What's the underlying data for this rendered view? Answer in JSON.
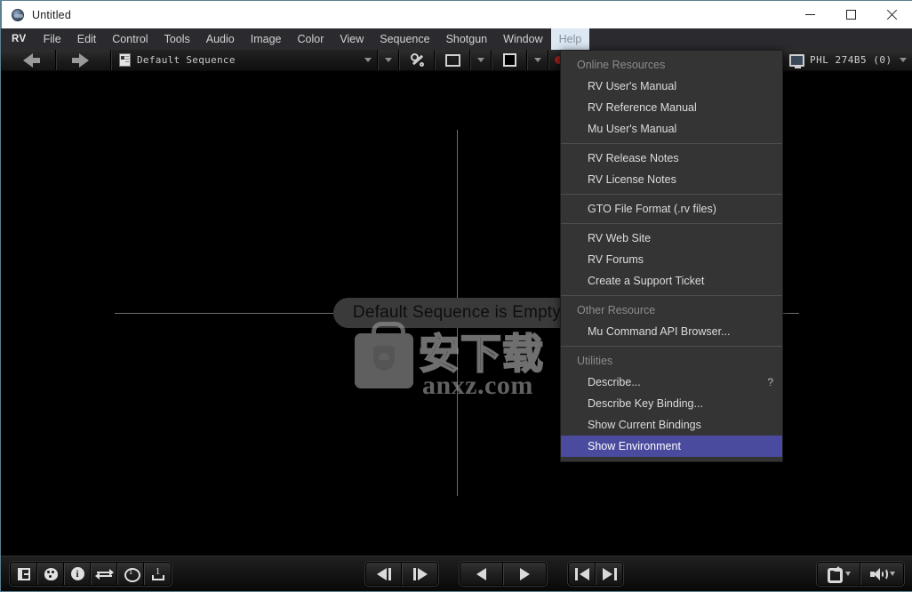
{
  "window": {
    "title": "Untitled",
    "icon": "rv-app-icon",
    "controls": {
      "minimize": "minimize-icon",
      "maximize": "maximize-icon",
      "close": "close-icon"
    }
  },
  "menubar": {
    "brand": "RV",
    "items": [
      {
        "label": "File",
        "active": false
      },
      {
        "label": "Edit",
        "active": false
      },
      {
        "label": "Control",
        "active": false
      },
      {
        "label": "Tools",
        "active": false
      },
      {
        "label": "Audio",
        "active": false
      },
      {
        "label": "Image",
        "active": false
      },
      {
        "label": "Color",
        "active": false
      },
      {
        "label": "View",
        "active": false
      },
      {
        "label": "Sequence",
        "active": false
      },
      {
        "label": "Shotgun",
        "active": false
      },
      {
        "label": "Window",
        "active": false
      },
      {
        "label": "Help",
        "active": true
      }
    ]
  },
  "toolbar": {
    "back_icon": "arrow-left-icon",
    "forward_icon": "arrow-right-icon",
    "sequence_icon": "document-icon",
    "sequence_label": "Default Sequence",
    "wrench_icon": "wrench-icon",
    "frame_icon": "frame-icon",
    "swatch_icon": "color-swatch-icon",
    "channels_icon": "rgb-channels-icon",
    "monitor_icon": "monitor-icon",
    "monitor_label": "PHL 274B5 (0)",
    "caret_icon": "chevron-down-icon"
  },
  "viewport": {
    "empty_message": "Default Sequence is Empty",
    "watermark": {
      "logo": "briefcase-shield-icon",
      "chinese_text": "安下载",
      "url_text": "anxz.com"
    }
  },
  "help_menu": {
    "sections": [
      {
        "header": "Online Resources",
        "items": [
          {
            "label": "RV User's Manual",
            "shortcut": "",
            "selected": false
          },
          {
            "label": "RV Reference Manual",
            "shortcut": "",
            "selected": false
          },
          {
            "label": "Mu User's Manual",
            "shortcut": "",
            "selected": false
          }
        ]
      },
      {
        "header": "",
        "items": [
          {
            "label": "RV Release Notes",
            "shortcut": "",
            "selected": false
          },
          {
            "label": "RV License Notes",
            "shortcut": "",
            "selected": false
          }
        ]
      },
      {
        "header": "",
        "items": [
          {
            "label": "GTO File Format (.rv files)",
            "shortcut": "",
            "selected": false
          }
        ]
      },
      {
        "header": "",
        "items": [
          {
            "label": "RV Web Site",
            "shortcut": "",
            "selected": false
          },
          {
            "label": "RV Forums",
            "shortcut": "",
            "selected": false
          },
          {
            "label": "Create a Support Ticket",
            "shortcut": "",
            "selected": false
          }
        ]
      },
      {
        "header": "Other Resource",
        "items": [
          {
            "label": "Mu Command API Browser...",
            "shortcut": "",
            "selected": false
          }
        ]
      },
      {
        "header": "Utilities",
        "items": [
          {
            "label": "Describe...",
            "shortcut": "?",
            "selected": false
          },
          {
            "label": "Describe Key Binding...",
            "shortcut": "",
            "selected": false
          },
          {
            "label": "Show Current Bindings",
            "shortcut": "",
            "selected": false
          },
          {
            "label": "Show Environment",
            "shortcut": "",
            "selected": true
          }
        ]
      }
    ]
  },
  "bottombar": {
    "left_tools": [
      {
        "icon": "panel-toggle-icon"
      },
      {
        "icon": "color-palette-icon"
      },
      {
        "icon": "info-icon"
      },
      {
        "icon": "swap-arrows-icon"
      },
      {
        "icon": "frame-number-icon"
      },
      {
        "icon": "inout-range-icon"
      }
    ],
    "transport_step": [
      {
        "icon": "step-backward-icon"
      },
      {
        "icon": "step-forward-icon"
      }
    ],
    "transport_play": [
      {
        "icon": "play-backward-icon"
      },
      {
        "icon": "play-forward-icon"
      }
    ],
    "transport_jump": [
      {
        "icon": "skip-to-start-icon"
      },
      {
        "icon": "skip-to-end-icon"
      }
    ],
    "right_tools": [
      {
        "icon": "loop-icon"
      },
      {
        "icon": "volume-icon"
      }
    ]
  },
  "colors": {
    "menu_highlight": "#4a4a9e",
    "menu_bg": "#343434",
    "menubar_bg": "#2b2b2f",
    "active_menu_bg": "#dce9f5",
    "viewport_bg": "#000000"
  }
}
